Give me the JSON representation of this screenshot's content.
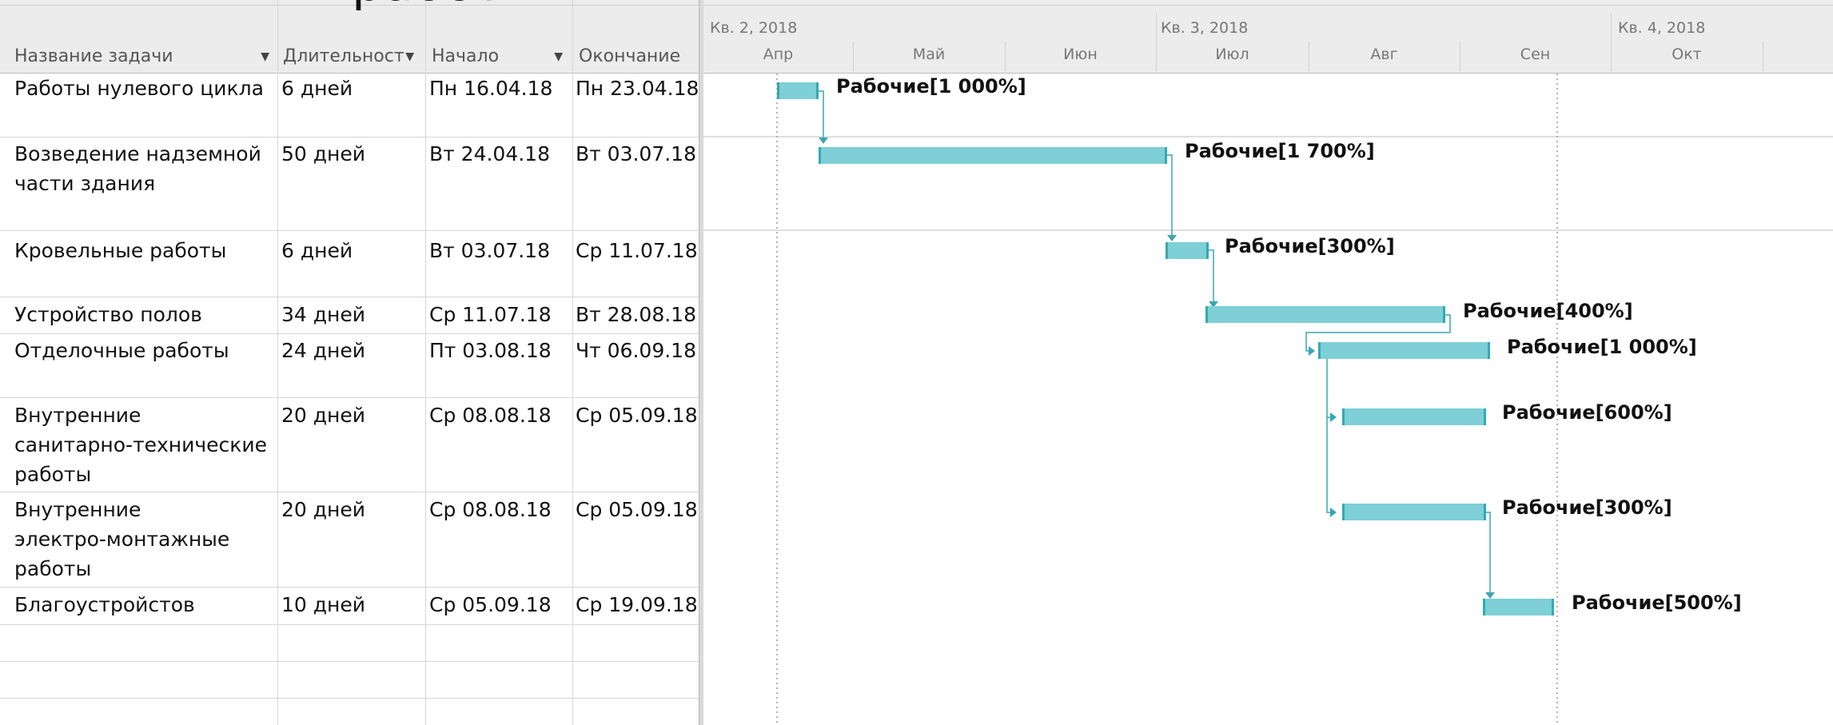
{
  "slide_title_fragment": "работ",
  "timescale": {
    "quarters": [
      "Кв. 2, 2018",
      "Кв. 3, 2018",
      "Кв. 4, 2018"
    ],
    "months": [
      "Апр",
      "Май",
      "Июн",
      "Июл",
      "Авг",
      "Сен",
      "Окт"
    ]
  },
  "columns": {
    "name": "Название задачи",
    "duration": "Длительност",
    "start": "Начало",
    "finish": "Окончание"
  },
  "tasks": [
    {
      "name": [
        "Работы нулевого цикла"
      ],
      "duration": "6 дней",
      "start": "Пн 16.04.18",
      "finish": "Пн 23.04.18",
      "resource": "Рабочие[1 000%]"
    },
    {
      "name": [
        "Возведение надземной",
        "части здания"
      ],
      "duration": "50 дней",
      "start": "Вт 24.04.18",
      "finish": "Вт 03.07.18",
      "resource": "Рабочие[1 700%]"
    },
    {
      "name": [
        "Кровельные работы"
      ],
      "duration": "6 дней",
      "start": "Вт 03.07.18",
      "finish": "Ср 11.07.18",
      "resource": "Рабочие[300%]"
    },
    {
      "name": [
        "Устройство полов"
      ],
      "duration": "34 дней",
      "start": "Ср 11.07.18",
      "finish": "Вт 28.08.18",
      "resource": "Рабочие[400%]"
    },
    {
      "name": [
        "Отделочные работы"
      ],
      "duration": "24 дней",
      "start": "Пт 03.08.18",
      "finish": "Чт 06.09.18",
      "resource": "Рабочие[1 000%]"
    },
    {
      "name": [
        "Внутренние",
        "санитарно-технические",
        "работы"
      ],
      "duration": "20 дней",
      "start": "Ср 08.08.18",
      "finish": "Ср 05.09.18",
      "resource": "Рабочие[600%]"
    },
    {
      "name": [
        "Внутренние",
        "электро-монтажные",
        "работы"
      ],
      "duration": "20 дней",
      "start": "Ср 08.08.18",
      "finish": "Ср 05.09.18",
      "resource": "Рабочие[300%]"
    },
    {
      "name": [
        "Благоустройстов"
      ],
      "duration": "10 дней",
      "start": "Ср 05.09.18",
      "finish": "Ср 19.09.18",
      "resource": "Рабочие[500%]"
    }
  ],
  "colors": {
    "bar_fill": "#7ecfd6",
    "bar_cap": "#33a9b4",
    "link": "#3aa6b0",
    "grid": "#d6d6d6"
  }
}
